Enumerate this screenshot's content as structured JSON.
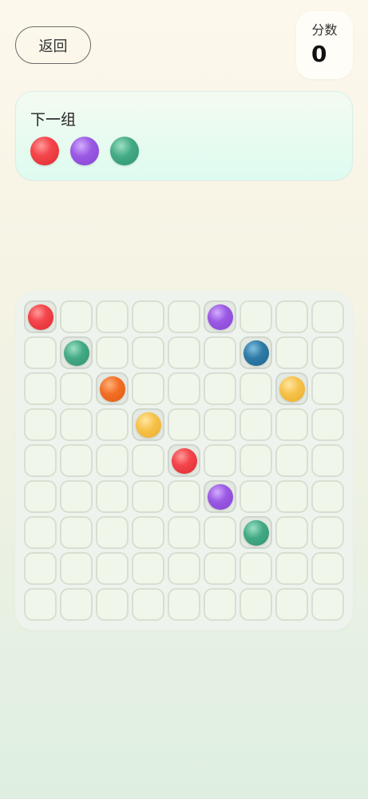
{
  "header": {
    "back_label": "返回",
    "score_label": "分数",
    "score_value": "0"
  },
  "next_group": {
    "title": "下一组",
    "balls": [
      "red",
      "purple",
      "green"
    ]
  },
  "board": {
    "rows": 9,
    "cols": 9,
    "pieces": [
      {
        "row": 0,
        "col": 0,
        "color": "red"
      },
      {
        "row": 0,
        "col": 5,
        "color": "purple"
      },
      {
        "row": 1,
        "col": 1,
        "color": "green"
      },
      {
        "row": 1,
        "col": 6,
        "color": "blue"
      },
      {
        "row": 2,
        "col": 2,
        "color": "orange"
      },
      {
        "row": 2,
        "col": 7,
        "color": "yellow"
      },
      {
        "row": 3,
        "col": 3,
        "color": "yellow"
      },
      {
        "row": 4,
        "col": 4,
        "color": "red"
      },
      {
        "row": 5,
        "col": 5,
        "color": "purple"
      },
      {
        "row": 6,
        "col": 6,
        "color": "green"
      }
    ]
  },
  "colors": {
    "red": "#f4464c",
    "purple": "#9b5ae3",
    "green": "#44aa85",
    "blue": "#2f7aa6",
    "orange": "#f36e25",
    "yellow": "#f6c24a"
  }
}
